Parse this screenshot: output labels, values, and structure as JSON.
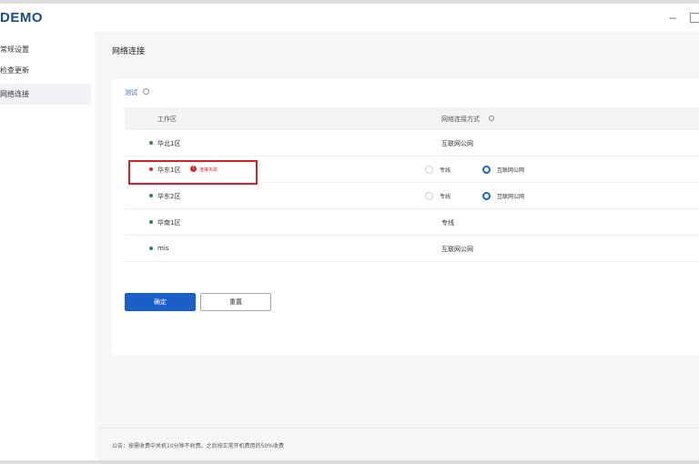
{
  "app": {
    "logo": "DEMO",
    "minimize": "−"
  },
  "sidebar": {
    "items": [
      {
        "label": "常规设置"
      },
      {
        "label": "检查更新"
      },
      {
        "label": "网络连接"
      }
    ],
    "active_index": 2
  },
  "main": {
    "title": "网络连接",
    "test_label": "测试",
    "table": {
      "headers": [
        "工作区",
        "网络连接方式"
      ],
      "rows": [
        {
          "zone": "华北1区",
          "status": "ok",
          "method": "互联网公网",
          "options": []
        },
        {
          "zone": "华东1区",
          "status": "error",
          "error_text": "连接失败",
          "method": "",
          "options": [
            "专线",
            "互联网公网"
          ],
          "selected": "互联网公网"
        },
        {
          "zone": "华东2区",
          "status": "ok",
          "method": "",
          "options": [
            "专线",
            "互联网公网"
          ],
          "selected": "互联网公网"
        },
        {
          "zone": "华南1区",
          "status": "ok",
          "method": "专线",
          "options": []
        },
        {
          "zone": "mis",
          "status": "ok",
          "method": "互联网公网",
          "options": []
        }
      ]
    },
    "buttons": {
      "confirm": "确定",
      "reset": "重置"
    }
  },
  "footer": {
    "notice": "公告：按需收费中关机10分钟不收费。之后按正常开机费用的50%收费"
  },
  "colors": {
    "accent": "#1a5fc8",
    "status_ok": "#2e8b3e",
    "status_error": "#d12b2b",
    "highlight_border": "#d61f26"
  }
}
